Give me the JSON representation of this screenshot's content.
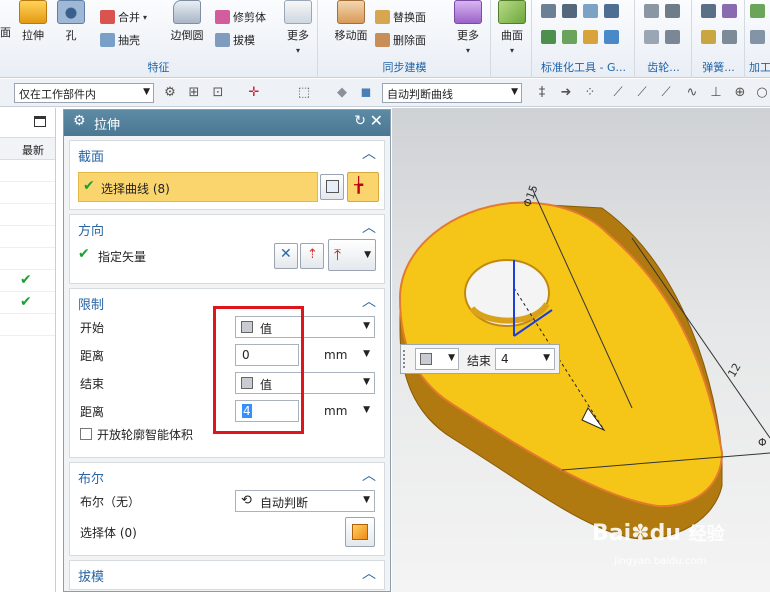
{
  "ribbon": {
    "top_left_label": "面",
    "extrude_label": "拉伸",
    "hole_label": "孔",
    "unite_label": "合并",
    "shell_label": "抽壳",
    "edge_blend_label": "边倒圆",
    "trim_body_label": "修剪体",
    "draft_label": "拔模",
    "more_label_1": "更多",
    "feature_group": "特征",
    "move_face_label": "移动面",
    "replace_face_label": "替换面",
    "delete_face_label": "删除面",
    "more_label_2": "更多",
    "sync_group": "同步建模",
    "surface_label": "曲面",
    "standard_tools_group": "标准化工具 - G...",
    "gear_group": "齿轮...",
    "spring_group": "弹簧...",
    "process_group": "加工"
  },
  "toolbar": {
    "scope_select": "仅在工作部件内",
    "curve_rule_select": "自动判断曲线"
  },
  "navigator": {
    "column_latest": "最新"
  },
  "dialog": {
    "title": "拉伸",
    "section_label": {
      "header": "截面",
      "select_curve": "选择曲线 (8)"
    },
    "direction": {
      "header": "方向",
      "specify_vector": "指定矢量"
    },
    "limits": {
      "header": "限制",
      "start_label": "开始",
      "start_option": "值",
      "distance_label_1": "距离",
      "start_distance": "0",
      "unit_1": "mm",
      "end_label": "结束",
      "end_option": "值",
      "distance_label_2": "距离",
      "end_distance": "4",
      "unit_2": "mm",
      "open_profile_checkbox": "开放轮廓智能体积"
    },
    "boolean": {
      "header": "布尔",
      "boolean_label": "布尔（无）",
      "boolean_option": "自动判断",
      "select_body": "选择体 (0)"
    },
    "draft": {
      "header": "拔模"
    }
  },
  "viewport_popup": {
    "end_label": "结束",
    "end_value": "4"
  },
  "model": {
    "dim_a": "Φ15",
    "dim_b": "12",
    "dim_c": "Φ"
  },
  "watermark": {
    "brand": "Bai",
    "brand_cn": "经验",
    "url": "jingyan.baidu.com"
  },
  "colors": {
    "accent": "#2a66a3",
    "dialog_title_bar": "#4a7792",
    "selected_row": "#fad56e",
    "part_yellow": "#f5c518",
    "annotation_red": "#e0141b",
    "check_green": "#1aa131"
  }
}
